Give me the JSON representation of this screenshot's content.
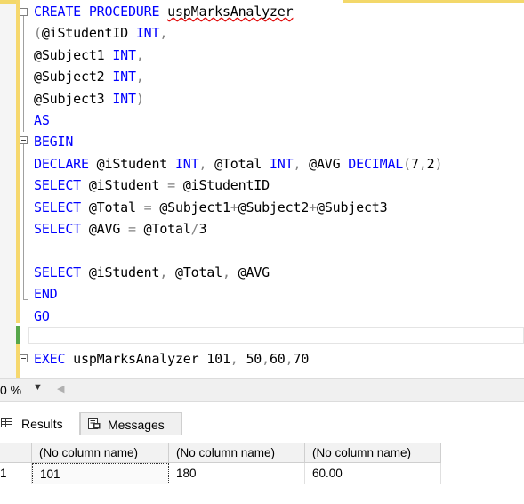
{
  "editor": {
    "lines": [
      [
        [
          "k",
          "CREATE PROCEDURE "
        ],
        [
          "pl",
          ""
        ],
        [
          "sq",
          "uspMarksAnalyzer"
        ]
      ],
      [
        [
          "g",
          "("
        ],
        [
          "pl",
          "@iStudentID "
        ],
        [
          "k",
          "INT"
        ],
        [
          "g",
          ","
        ]
      ],
      [
        [
          "pl",
          "@Subject1 "
        ],
        [
          "k",
          "INT"
        ],
        [
          "g",
          ","
        ]
      ],
      [
        [
          "pl",
          "@Subject2 "
        ],
        [
          "k",
          "INT"
        ],
        [
          "g",
          ","
        ]
      ],
      [
        [
          "pl",
          "@Subject3 "
        ],
        [
          "k",
          "INT"
        ],
        [
          "g",
          ")"
        ]
      ],
      [
        [
          "k",
          "AS"
        ]
      ],
      [
        [
          "k",
          "BEGIN"
        ]
      ],
      [
        [
          "k",
          "DECLARE "
        ],
        [
          "pl",
          "@iStudent "
        ],
        [
          "k",
          "INT"
        ],
        [
          "g",
          ", "
        ],
        [
          "pl",
          "@Total "
        ],
        [
          "k",
          "INT"
        ],
        [
          "g",
          ", "
        ],
        [
          "pl",
          "@AVG "
        ],
        [
          "k",
          "DECIMAL"
        ],
        [
          "g",
          "("
        ],
        [
          "pl",
          "7"
        ],
        [
          "g",
          ","
        ],
        [
          "pl",
          "2"
        ],
        [
          "g",
          ")"
        ]
      ],
      [
        [
          "k",
          "SELECT "
        ],
        [
          "pl",
          "@iStudent "
        ],
        [
          "g",
          "= "
        ],
        [
          "pl",
          "@iStudentID"
        ]
      ],
      [
        [
          "k",
          "SELECT "
        ],
        [
          "pl",
          "@Total "
        ],
        [
          "g",
          "= "
        ],
        [
          "pl",
          "@Subject1"
        ],
        [
          "g",
          "+"
        ],
        [
          "pl",
          "@Subject2"
        ],
        [
          "g",
          "+"
        ],
        [
          "pl",
          "@Subject3"
        ]
      ],
      [
        [
          "k",
          "SELECT "
        ],
        [
          "pl",
          "@AVG "
        ],
        [
          "g",
          "= "
        ],
        [
          "pl",
          "@Total"
        ],
        [
          "g",
          "/"
        ],
        [
          "pl",
          "3"
        ]
      ],
      [],
      [
        [
          "k",
          "SELECT "
        ],
        [
          "pl",
          "@iStudent"
        ],
        [
          "g",
          ", "
        ],
        [
          "pl",
          "@Total"
        ],
        [
          "g",
          ", "
        ],
        [
          "pl",
          "@AVG"
        ]
      ],
      [
        [
          "k",
          "END"
        ]
      ],
      [
        [
          "k",
          "GO"
        ]
      ],
      [],
      [
        [
          "k",
          "EXEC "
        ],
        [
          "pl",
          "uspMarksAnalyzer 101"
        ],
        [
          "g",
          ", "
        ],
        [
          "pl",
          "50"
        ],
        [
          "g",
          ","
        ],
        [
          "pl",
          "60"
        ],
        [
          "g",
          ","
        ],
        [
          "pl",
          "70"
        ]
      ]
    ]
  },
  "status": {
    "zoom": "0 %",
    "zoom_dropdown_icon": "chevron-down-icon",
    "scroll_left_icon": "scroll-left-icon"
  },
  "tabs": {
    "results_label": "Results",
    "messages_label": "Messages"
  },
  "results": {
    "columns": [
      "(No column name)",
      "(No column name)",
      "(No column name)"
    ],
    "rows": [
      {
        "num": "1",
        "cells": [
          "101",
          "180",
          "60.00"
        ]
      }
    ]
  },
  "colors": {
    "keyword": "#0000ff",
    "operator": "#808080",
    "change_bar_saved": "#57a64a",
    "change_bar_unsaved": "#f6d86e"
  }
}
